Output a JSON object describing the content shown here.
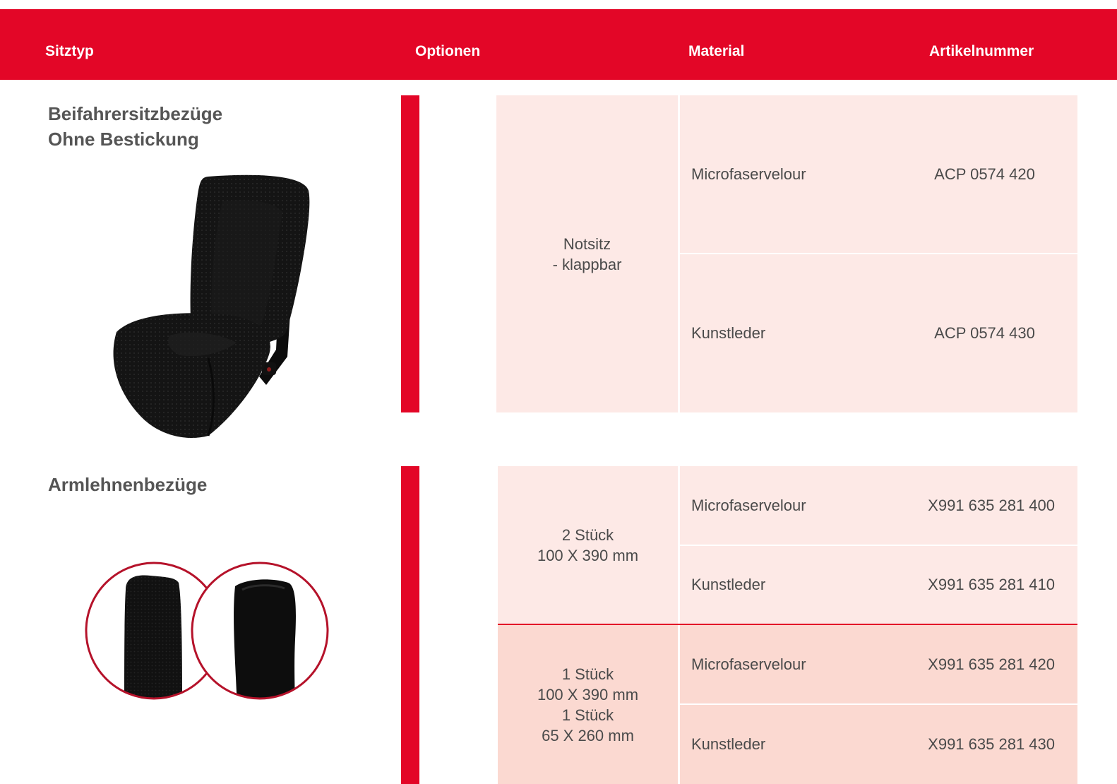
{
  "header": {
    "col_sitztyp": "Sitztyp",
    "col_optionen": "Optionen",
    "col_material": "Material",
    "col_artikelnummer": "Artikelnummer"
  },
  "colors": {
    "brand_red": "#e30627",
    "row_light": "#fde9e6",
    "row_dark": "#fbd9d1"
  },
  "section1": {
    "title_line1": "Beifahrersitzbezüge",
    "title_line2": "Ohne Bestickung",
    "option_line1": "Notsitz",
    "option_line2": "- klappbar",
    "rows": [
      {
        "material": "Microfaservelour",
        "artikel": "ACP 0574 420"
      },
      {
        "material": "Kunstleder",
        "artikel": "ACP 0574 430"
      }
    ]
  },
  "section2": {
    "title": "Armlehnenbezüge",
    "groups": [
      {
        "option_lines": [
          "2 Stück",
          "100 X 390 mm"
        ],
        "rows": [
          {
            "material": "Microfaservelour",
            "artikel": "X991 635 281 400"
          },
          {
            "material": "Kunstleder",
            "artikel": "X991 635 281 410"
          }
        ]
      },
      {
        "option_lines": [
          "1 Stück",
          "100 X 390 mm",
          "1 Stück",
          "65 X 260 mm"
        ],
        "rows": [
          {
            "material": "Microfaservelour",
            "artikel": "X991 635 281 420"
          },
          {
            "material": "Kunstleder",
            "artikel": "X991 635 281 430"
          }
        ]
      }
    ]
  }
}
